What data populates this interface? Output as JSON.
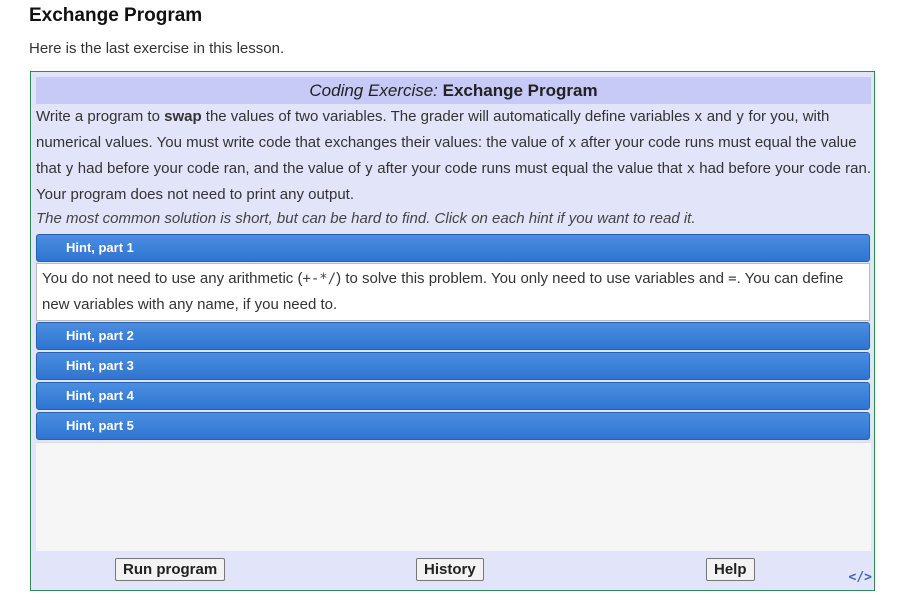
{
  "page": {
    "title": "Exchange Program",
    "intro": "Here is the last exercise in this lesson."
  },
  "exercise": {
    "label": "Coding Exercise:",
    "name": "Exchange Program",
    "desc_1": "Write a program to ",
    "desc_swap": "swap",
    "desc_2": " the values of two variables. The grader will automatically define variables ",
    "var_x": "x",
    "desc_3": " and ",
    "var_y": "y",
    "desc_4": " for you, with numerical values. You must write code that exchanges their values: the value of ",
    "desc_5": " after your code runs must equal the value that ",
    "desc_6": " had before your code ran, and the value of ",
    "desc_7": " after your code runs must equal the value that ",
    "desc_8": " had before your code ran. Your program does not need to print any output.",
    "note": "The most common solution is short, but can be hard to find. Click on each hint if you want to read it."
  },
  "hints": [
    {
      "label": "Hint, part 1"
    },
    {
      "label": "Hint, part 2"
    },
    {
      "label": "Hint, part 3"
    },
    {
      "label": "Hint, part 4"
    },
    {
      "label": "Hint, part 5"
    }
  ],
  "hint1_body": {
    "text_1": "You do not need to use any arithmetic (",
    "ops": "+-*/",
    "text_2": ") to solve this problem. You only need to use variables and ",
    "eq": "=",
    "text_3": ". You can define new variables with any name, if you need to."
  },
  "buttons": {
    "run": "Run program",
    "history": "History",
    "help": "Help"
  },
  "embed_icon": "</>"
}
